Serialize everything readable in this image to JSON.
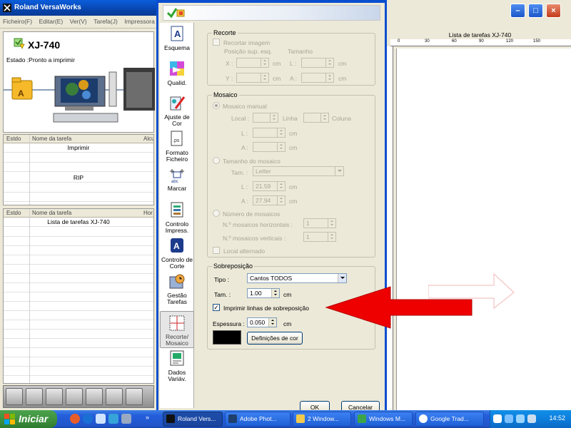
{
  "versaworks": {
    "title": "Roland VersaWorks",
    "menu": [
      "Ficheiro(F)",
      "Editar(E)",
      "Ver(V)",
      "Tarefa(J)",
      "Impressora"
    ],
    "printer_name": "XJ-740",
    "printer_status": "Estado :Pronto a imprimir",
    "queue_columns": [
      "Estdo",
      "Nome da tarefa",
      "Alcu"
    ],
    "queue_rows": [
      "Imprimir",
      "RIP"
    ],
    "library_columns": [
      "Estdo",
      "Nome da tarefa",
      "Hor"
    ],
    "library_title": "Lista de tarefas XJ-740"
  },
  "canvas": {
    "label": "Lista de tarefas XJ-740",
    "ruler_numbers": [
      "0",
      "30",
      "60",
      "90",
      "120",
      "150"
    ]
  },
  "dialog": {
    "nav": [
      {
        "label": "Esquema"
      },
      {
        "label": "Qualid."
      },
      {
        "label": "Ajuste de Cor"
      },
      {
        "label": "Formato Ficheiro"
      },
      {
        "label": "Marcar"
      },
      {
        "label": "Controlo Impress."
      },
      {
        "label": "Controlo de Corte"
      },
      {
        "label": "Gestão Tarefas"
      },
      {
        "label": "Recorte/ Mosaico"
      },
      {
        "label": "Dados Variáv."
      }
    ],
    "recorte": {
      "title": "Recorte",
      "crop_checkbox": "Recortar imagem",
      "pos_label": "Posição sup. esq.",
      "size_label": "Tamanho",
      "x_label": "X :",
      "y_label": "Y :",
      "w_label": "L :",
      "h_label": "A :",
      "unit": "cm"
    },
    "mosaico": {
      "title": "Mosaico",
      "manual_radio": "Mosaico manual",
      "local_label": "Local :",
      "linha_label": "Linha",
      "coluna_label": "Coluna",
      "l_label": "L :",
      "a_label": "A :",
      "unit": "cm",
      "size_radio": "Tamanho do mosaico",
      "tam_label": "Tam. :",
      "tam_value": "Letter",
      "size_w_value": "21.59",
      "size_h_value": "27.94",
      "count_radio": "Número de mosaicos",
      "horiz_label": "N.º mosaicos horizontais :",
      "vert_label": "N.º mosaicos verticais :",
      "horiz_value": "1",
      "vert_value": "1",
      "alternate_checkbox": "Local alternado"
    },
    "sobreposicao": {
      "title": "Sobreposição",
      "tipo_label": "Tipo :",
      "tipo_value": "Cantos TODOS",
      "tam_label": "Tam. :",
      "tam_value": "1.00",
      "unit": "cm",
      "print_lines_checkbox": "Imprimir linhas de sobreposição",
      "espessura_label": "Espessura :",
      "espessura_value": "0.050",
      "color_button": "Definições de cor"
    },
    "ok_button": "OK",
    "cancel_button": "Cancelar"
  },
  "taskbar": {
    "start_label": "Iniciar",
    "tasks": [
      "Roland Vers...",
      "Adobe Phot...",
      "2 Window...",
      "Windows M...",
      "Google Trad..."
    ],
    "clock": "14:52",
    "colors": {
      "start": "#3c8e3c",
      "bar": "#245edb",
      "tray": "#0c7ad8"
    }
  },
  "accent_colors": {
    "arrow": "#ee0000",
    "title_bar": "#0a4ed0"
  }
}
